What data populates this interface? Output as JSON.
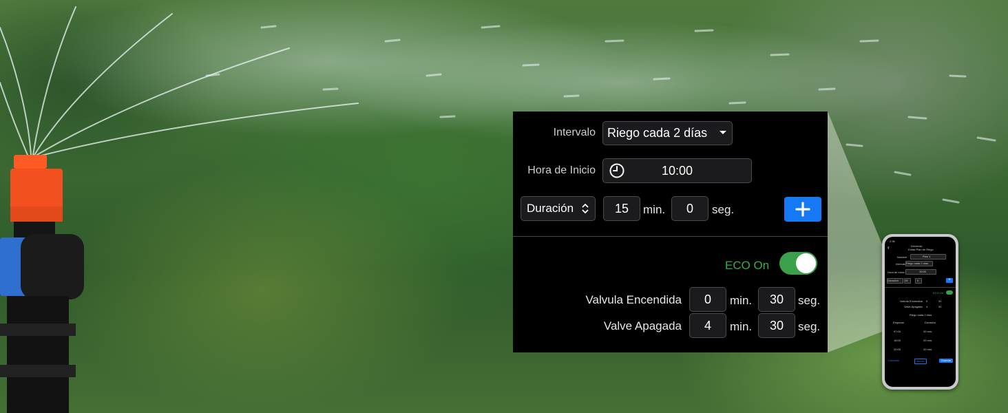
{
  "colors": {
    "accent_blue": "#1479f2",
    "eco_green": "#2fb24e",
    "toggle_green": "#3aa14a",
    "panel_bg": "#000000"
  },
  "form": {
    "interval": {
      "label": "Intervalo",
      "value": "Riego cada 2 días",
      "icon": "caret-down-icon"
    },
    "start_time": {
      "label": "Hora de Inicio",
      "value": "10:00",
      "icon": "clock-icon"
    },
    "duration": {
      "mode": "Duración",
      "minutes": "15",
      "min_unit": "min.",
      "seconds": "0",
      "sec_unit": "seg.",
      "add_icon": "plus-icon"
    }
  },
  "eco": {
    "label": "ECO On",
    "enabled": true,
    "valve_on": {
      "label": "Valvula Encendida",
      "minutes": "0",
      "min_unit": "min.",
      "seconds": "30",
      "sec_unit": "seg."
    },
    "valve_off": {
      "label": "Valve Apagada",
      "minutes": "4",
      "min_unit": "min.",
      "seconds": "30",
      "sec_unit": "seg."
    }
  },
  "phone": {
    "status_time": "2:36",
    "nav_title_1": "Dirvinmix",
    "nav_title_2": "Editar Plan de Riego",
    "name_label": "Nombre",
    "name_value": "Plan 1",
    "interval_label": "Intervalo",
    "interval_value": "Riego cada 2 días",
    "start_label": "Hora de Inicio",
    "start_value": "10:00",
    "duration_mode": "Duración",
    "duration_min": "15",
    "duration_sec": "0",
    "eco_label": "ECO On",
    "valve_on_label": "Valvula Encendida",
    "valve_on_min": "0",
    "valve_on_sec": "30",
    "valve_off_label": "Valve Apagada",
    "valve_off_min": "4",
    "valve_off_sec": "30",
    "schedule_title": "Riego cada 2 días",
    "col_start": "Empezar",
    "col_duration": "Duración",
    "rows": [
      {
        "start": "07:00",
        "duration": "20 min."
      },
      {
        "start": "18:00",
        "duration": "20 min."
      },
      {
        "start": "20:00",
        "duration": "20 min."
      }
    ],
    "cancel": "Cancelar",
    "delete": "Borrar",
    "save": "Guardar"
  }
}
